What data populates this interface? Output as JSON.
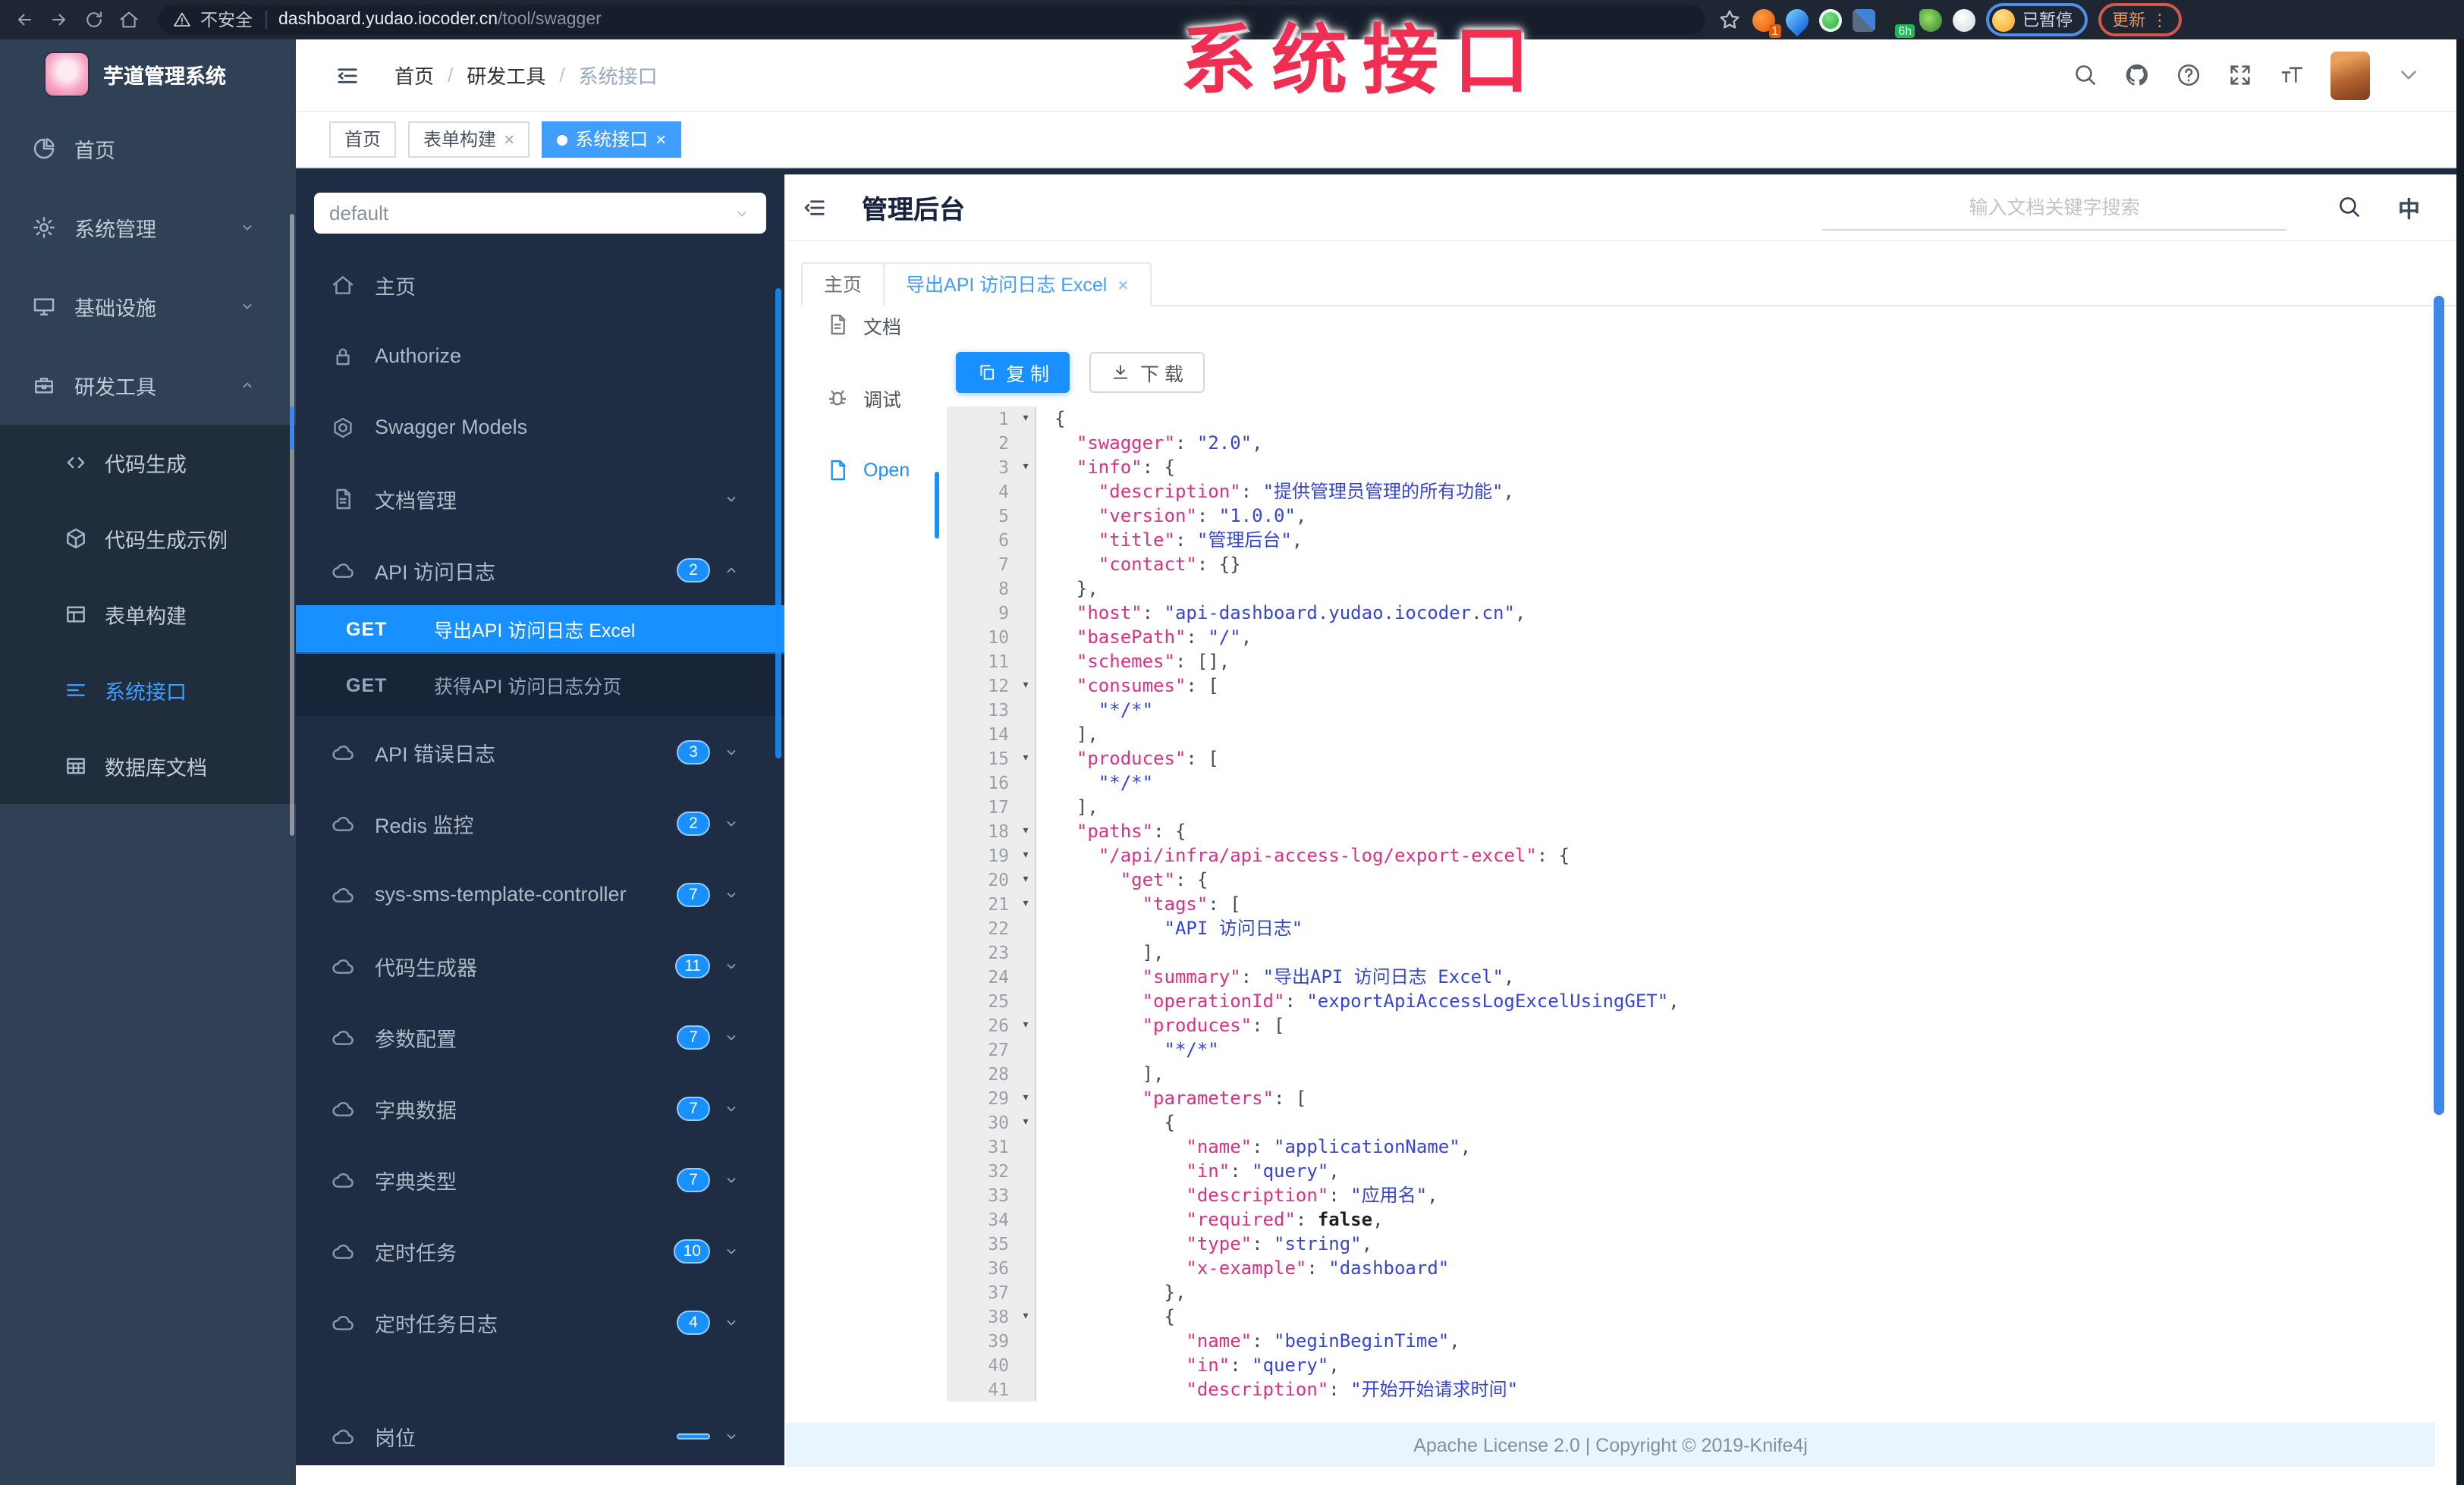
{
  "watermark": "系统接口",
  "browser": {
    "security_label": "不安全",
    "url_host": "dashboard.yudao.iocoder.cn",
    "url_path": "/tool/swagger",
    "profile_label": "已暂停",
    "update_label": "更新",
    "extensions": [
      {
        "name": "extension-orange-icon",
        "cls": "orange",
        "badge": "1"
      },
      {
        "name": "extension-drop-icon",
        "cls": "drop"
      },
      {
        "name": "extension-green-check-icon",
        "cls": "green"
      },
      {
        "name": "extension-grid-icon",
        "cls": "grid"
      },
      {
        "name": "extension-screenshot-icon",
        "cls": "dark",
        "badge": "6h",
        "badge_cls": "gr"
      },
      {
        "name": "extension-leaf-icon",
        "cls": "leaf"
      },
      {
        "name": "extension-paw-icon",
        "cls": "paw"
      }
    ]
  },
  "sidebar": {
    "title": "芋道管理系统",
    "items": [
      {
        "label": "首页",
        "icon": "pie"
      },
      {
        "label": "系统管理",
        "icon": "gear",
        "chevron": "down"
      },
      {
        "label": "基础设施",
        "icon": "monitor",
        "chevron": "down"
      },
      {
        "label": "研发工具",
        "icon": "case",
        "chevron": "up"
      }
    ],
    "subitems": [
      {
        "label": "代码生成",
        "icon": "code"
      },
      {
        "label": "代码生成示例",
        "icon": "cube"
      },
      {
        "label": "表单构建",
        "icon": "form"
      },
      {
        "label": "系统接口",
        "icon": "apilines",
        "active": true
      },
      {
        "label": "数据库文档",
        "icon": "dbdoc"
      }
    ]
  },
  "header": {
    "breadcrumb": [
      "首页",
      "研发工具",
      "系统接口"
    ]
  },
  "tags": [
    {
      "label": "首页"
    },
    {
      "label": "表单构建",
      "closable": true
    },
    {
      "label": "系统接口",
      "closable": true,
      "active": true
    }
  ],
  "panel": {
    "group_value": "default",
    "items": [
      {
        "label": "主页",
        "icon": "home"
      },
      {
        "label": "Authorize",
        "icon": "lock"
      },
      {
        "label": "Swagger Models",
        "icon": "hex"
      },
      {
        "label": "文档管理",
        "icon": "filedoc",
        "chevron": "down"
      },
      {
        "label": "API 访问日志",
        "icon": "cloud",
        "badge": "2",
        "chevron": "up"
      }
    ],
    "operations": [
      {
        "method": "GET",
        "label": "导出API 访问日志 Excel",
        "active": true
      },
      {
        "method": "GET",
        "label": "获得API 访问日志分页"
      }
    ],
    "groups": [
      {
        "label": "API 错误日志",
        "badge": "3"
      },
      {
        "label": "Redis 监控",
        "badge": "2"
      },
      {
        "label": "sys-sms-template-controller",
        "badge": "7"
      },
      {
        "label": "代码生成器",
        "badge": "11"
      },
      {
        "label": "参数配置",
        "badge": "7"
      },
      {
        "label": "字典数据",
        "badge": "7"
      },
      {
        "label": "字典类型",
        "badge": "7"
      },
      {
        "label": "定时任务",
        "badge": "10"
      },
      {
        "label": "定时任务日志",
        "badge": "4"
      },
      {
        "label": "岗位",
        "badge": "",
        "partial": true
      }
    ]
  },
  "main": {
    "title": "管理后台",
    "search_placeholder": "输入文档关键字搜索",
    "lang_label": "中",
    "doc_tabs": [
      {
        "label": "主页"
      },
      {
        "label": "导出API 访问日志 Excel",
        "closable": true,
        "active": true
      }
    ],
    "mini_menu": [
      {
        "label": "文档",
        "icon": "filedoc"
      },
      {
        "label": "调试",
        "icon": "bug"
      },
      {
        "label": "Open",
        "icon": "openfile",
        "active": true
      }
    ],
    "copy_label": "复 制",
    "download_label": "下 载",
    "footer": "Apache License 2.0 | Copyright © 2019-Knife4j"
  },
  "code": {
    "lines": [
      {
        "n": 1,
        "f": 1,
        "i": 0,
        "t": [
          [
            "p",
            "{"
          ]
        ]
      },
      {
        "n": 2,
        "f": 0,
        "i": 1,
        "t": [
          [
            "k",
            "\"swagger\""
          ],
          [
            "p",
            ": "
          ],
          [
            "s",
            "\"2.0\""
          ],
          [
            "p",
            ","
          ]
        ]
      },
      {
        "n": 3,
        "f": 1,
        "i": 1,
        "t": [
          [
            "k",
            "\"info\""
          ],
          [
            "p",
            ": {"
          ]
        ]
      },
      {
        "n": 4,
        "f": 0,
        "i": 2,
        "t": [
          [
            "k",
            "\"description\""
          ],
          [
            "p",
            ": "
          ],
          [
            "s",
            "\"提供管理员管理的所有功能\""
          ],
          [
            "p",
            ","
          ]
        ]
      },
      {
        "n": 5,
        "f": 0,
        "i": 2,
        "t": [
          [
            "k",
            "\"version\""
          ],
          [
            "p",
            ": "
          ],
          [
            "s",
            "\"1.0.0\""
          ],
          [
            "p",
            ","
          ]
        ]
      },
      {
        "n": 6,
        "f": 0,
        "i": 2,
        "t": [
          [
            "k",
            "\"title\""
          ],
          [
            "p",
            ": "
          ],
          [
            "s",
            "\"管理后台\""
          ],
          [
            "p",
            ","
          ]
        ]
      },
      {
        "n": 7,
        "f": 0,
        "i": 2,
        "t": [
          [
            "k",
            "\"contact\""
          ],
          [
            "p",
            ": {}"
          ]
        ]
      },
      {
        "n": 8,
        "f": 0,
        "i": 1,
        "t": [
          [
            "p",
            "},"
          ]
        ]
      },
      {
        "n": 9,
        "f": 0,
        "i": 1,
        "t": [
          [
            "k",
            "\"host\""
          ],
          [
            "p",
            ": "
          ],
          [
            "s",
            "\"api-dashboard.yudao.iocoder.cn\""
          ],
          [
            "p",
            ","
          ]
        ]
      },
      {
        "n": 10,
        "f": 0,
        "i": 1,
        "t": [
          [
            "k",
            "\"basePath\""
          ],
          [
            "p",
            ": "
          ],
          [
            "s",
            "\"/\""
          ],
          [
            "p",
            ","
          ]
        ]
      },
      {
        "n": 11,
        "f": 0,
        "i": 1,
        "t": [
          [
            "k",
            "\"schemes\""
          ],
          [
            "p",
            ": [],"
          ]
        ]
      },
      {
        "n": 12,
        "f": 1,
        "i": 1,
        "t": [
          [
            "k",
            "\"consumes\""
          ],
          [
            "p",
            ": ["
          ]
        ]
      },
      {
        "n": 13,
        "f": 0,
        "i": 2,
        "t": [
          [
            "s",
            "\"*/*\""
          ]
        ]
      },
      {
        "n": 14,
        "f": 0,
        "i": 1,
        "t": [
          [
            "p",
            "],"
          ]
        ]
      },
      {
        "n": 15,
        "f": 1,
        "i": 1,
        "t": [
          [
            "k",
            "\"produces\""
          ],
          [
            "p",
            ": ["
          ]
        ]
      },
      {
        "n": 16,
        "f": 0,
        "i": 2,
        "t": [
          [
            "s",
            "\"*/*\""
          ]
        ]
      },
      {
        "n": 17,
        "f": 0,
        "i": 1,
        "t": [
          [
            "p",
            "],"
          ]
        ]
      },
      {
        "n": 18,
        "f": 1,
        "i": 1,
        "t": [
          [
            "k",
            "\"paths\""
          ],
          [
            "p",
            ": {"
          ]
        ]
      },
      {
        "n": 19,
        "f": 1,
        "i": 2,
        "t": [
          [
            "k",
            "\"/api/infra/api-access-log/export-excel\""
          ],
          [
            "p",
            ": {"
          ]
        ]
      },
      {
        "n": 20,
        "f": 1,
        "i": 3,
        "t": [
          [
            "k",
            "\"get\""
          ],
          [
            "p",
            ": {"
          ]
        ]
      },
      {
        "n": 21,
        "f": 1,
        "i": 4,
        "t": [
          [
            "k",
            "\"tags\""
          ],
          [
            "p",
            ": ["
          ]
        ]
      },
      {
        "n": 22,
        "f": 0,
        "i": 5,
        "t": [
          [
            "s",
            "\"API 访问日志\""
          ]
        ]
      },
      {
        "n": 23,
        "f": 0,
        "i": 4,
        "t": [
          [
            "p",
            "],"
          ]
        ]
      },
      {
        "n": 24,
        "f": 0,
        "i": 4,
        "t": [
          [
            "k",
            "\"summary\""
          ],
          [
            "p",
            ": "
          ],
          [
            "s",
            "\"导出API 访问日志 Excel\""
          ],
          [
            "p",
            ","
          ]
        ]
      },
      {
        "n": 25,
        "f": 0,
        "i": 4,
        "t": [
          [
            "k",
            "\"operationId\""
          ],
          [
            "p",
            ": "
          ],
          [
            "s",
            "\"exportApiAccessLogExcelUsingGET\""
          ],
          [
            "p",
            ","
          ]
        ]
      },
      {
        "n": 26,
        "f": 1,
        "i": 4,
        "t": [
          [
            "k",
            "\"produces\""
          ],
          [
            "p",
            ": ["
          ]
        ]
      },
      {
        "n": 27,
        "f": 0,
        "i": 5,
        "t": [
          [
            "s",
            "\"*/*\""
          ]
        ]
      },
      {
        "n": 28,
        "f": 0,
        "i": 4,
        "t": [
          [
            "p",
            "],"
          ]
        ]
      },
      {
        "n": 29,
        "f": 1,
        "i": 4,
        "t": [
          [
            "k",
            "\"parameters\""
          ],
          [
            "p",
            ": ["
          ]
        ]
      },
      {
        "n": 30,
        "f": 1,
        "i": 5,
        "t": [
          [
            "p",
            "{"
          ]
        ]
      },
      {
        "n": 31,
        "f": 0,
        "i": 6,
        "t": [
          [
            "k",
            "\"name\""
          ],
          [
            "p",
            ": "
          ],
          [
            "s",
            "\"applicationName\""
          ],
          [
            "p",
            ","
          ]
        ]
      },
      {
        "n": 32,
        "f": 0,
        "i": 6,
        "t": [
          [
            "k",
            "\"in\""
          ],
          [
            "p",
            ": "
          ],
          [
            "s",
            "\"query\""
          ],
          [
            "p",
            ","
          ]
        ]
      },
      {
        "n": 33,
        "f": 0,
        "i": 6,
        "t": [
          [
            "k",
            "\"description\""
          ],
          [
            "p",
            ": "
          ],
          [
            "s",
            "\"应用名\""
          ],
          [
            "p",
            ","
          ]
        ]
      },
      {
        "n": 34,
        "f": 0,
        "i": 6,
        "t": [
          [
            "k",
            "\"required\""
          ],
          [
            "p",
            ": "
          ],
          [
            "b",
            "false"
          ],
          [
            "p",
            ","
          ]
        ]
      },
      {
        "n": 35,
        "f": 0,
        "i": 6,
        "t": [
          [
            "k",
            "\"type\""
          ],
          [
            "p",
            ": "
          ],
          [
            "s",
            "\"string\""
          ],
          [
            "p",
            ","
          ]
        ]
      },
      {
        "n": 36,
        "f": 0,
        "i": 6,
        "t": [
          [
            "k",
            "\"x-example\""
          ],
          [
            "p",
            ": "
          ],
          [
            "s",
            "\"dashboard\""
          ]
        ]
      },
      {
        "n": 37,
        "f": 0,
        "i": 5,
        "t": [
          [
            "p",
            "},"
          ]
        ]
      },
      {
        "n": 38,
        "f": 1,
        "i": 5,
        "t": [
          [
            "p",
            "{"
          ]
        ]
      },
      {
        "n": 39,
        "f": 0,
        "i": 6,
        "t": [
          [
            "k",
            "\"name\""
          ],
          [
            "p",
            ": "
          ],
          [
            "s",
            "\"beginBeginTime\""
          ],
          [
            "p",
            ","
          ]
        ]
      },
      {
        "n": 40,
        "f": 0,
        "i": 6,
        "t": [
          [
            "k",
            "\"in\""
          ],
          [
            "p",
            ": "
          ],
          [
            "s",
            "\"query\""
          ],
          [
            "p",
            ","
          ]
        ]
      },
      {
        "n": 41,
        "f": 0,
        "i": 6,
        "t": [
          [
            "k",
            "\"description\""
          ],
          [
            "p",
            ": "
          ],
          [
            "s",
            "\"开始开始请求时间\""
          ]
        ]
      }
    ]
  }
}
